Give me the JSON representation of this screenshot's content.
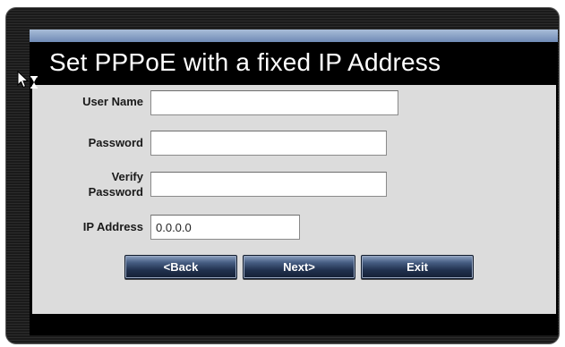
{
  "dialog": {
    "title": "Set PPPoE with a fixed IP Address"
  },
  "form": {
    "user_name": {
      "label": "User Name",
      "value": ""
    },
    "password": {
      "label": "Password",
      "value": ""
    },
    "verify_password": {
      "label_line1": "Verify",
      "label_line2": "Password",
      "value": ""
    },
    "ip_address": {
      "label": "IP Address",
      "value": "0.0.0.0"
    }
  },
  "buttons": {
    "back": "<Back",
    "next": "Next>",
    "exit": "Exit"
  },
  "colors": {
    "frame": "#242424",
    "panel": "#dcdcdc",
    "title_bar_accent": "#7f98c1",
    "button": "#20304d"
  },
  "icons": {
    "cursor": "busy-arrow-cursor-icon"
  }
}
